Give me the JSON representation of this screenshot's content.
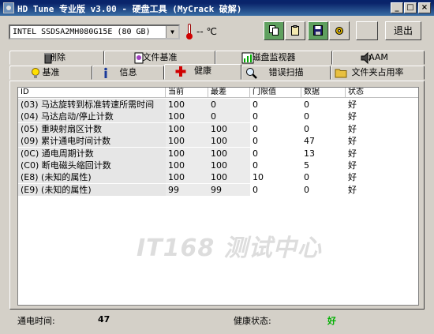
{
  "window": {
    "title": "HD Tune 专业版 v3.00 - 硬盘工具 (MyCrack 破解)",
    "minimize": "_",
    "maximize": "□",
    "close": "×"
  },
  "toolbar": {
    "drive": "INTEL SSDSA2MH080G15E (80 GB)",
    "temperature": "-- ℃",
    "exit_label": "退出"
  },
  "tabs_top": [
    {
      "label": "删除",
      "icon": "trash-icon"
    },
    {
      "label": "文件基准",
      "icon": "file-benchmark-icon"
    },
    {
      "label": "磁盘监视器",
      "icon": "disk-monitor-icon"
    },
    {
      "label": "AAM",
      "icon": "speaker-icon"
    }
  ],
  "tabs_bottom": [
    {
      "label": "基准",
      "icon": "lightbulb-icon"
    },
    {
      "label": "信息",
      "icon": "info-icon"
    },
    {
      "label": "健康",
      "icon": "health-cross-icon"
    },
    {
      "label": "错误扫描",
      "icon": "magnifier-icon"
    },
    {
      "label": "文件夹占用率",
      "icon": "folder-icon"
    }
  ],
  "smart_table": {
    "columns": [
      "ID",
      "当前",
      "最差",
      "门限值",
      "数据",
      "状态"
    ],
    "rows": [
      {
        "id": "(03) 马达旋转到标准转速所需时间",
        "current": "100",
        "worst": "0",
        "threshold": "0",
        "data": "0",
        "status": "好"
      },
      {
        "id": "(04) 马达启动/停止计数",
        "current": "100",
        "worst": "0",
        "threshold": "0",
        "data": "0",
        "status": "好"
      },
      {
        "id": "(05) 重映射扇区计数",
        "current": "100",
        "worst": "100",
        "threshold": "0",
        "data": "0",
        "status": "好"
      },
      {
        "id": "(09) 累计通电时间计数",
        "current": "100",
        "worst": "100",
        "threshold": "0",
        "data": "47",
        "status": "好"
      },
      {
        "id": "(0C) 通电周期计数",
        "current": "100",
        "worst": "100",
        "threshold": "0",
        "data": "13",
        "status": "好"
      },
      {
        "id": "(C0) 断电磁头缩回计数",
        "current": "100",
        "worst": "100",
        "threshold": "0",
        "data": "5",
        "status": "好"
      },
      {
        "id": "(E8) (未知的属性)",
        "current": "100",
        "worst": "100",
        "threshold": "10",
        "data": "0",
        "status": "好"
      },
      {
        "id": "(E9) (未知的属性)",
        "current": "99",
        "worst": "99",
        "threshold": "0",
        "data": "0",
        "status": "好"
      }
    ]
  },
  "watermark": "IT168 测试中心",
  "status_bar": {
    "power_on_label": "通电时间:",
    "power_on_value": "47",
    "health_label": "健康状态:",
    "health_value": "好",
    "health_color": "#00b000"
  }
}
